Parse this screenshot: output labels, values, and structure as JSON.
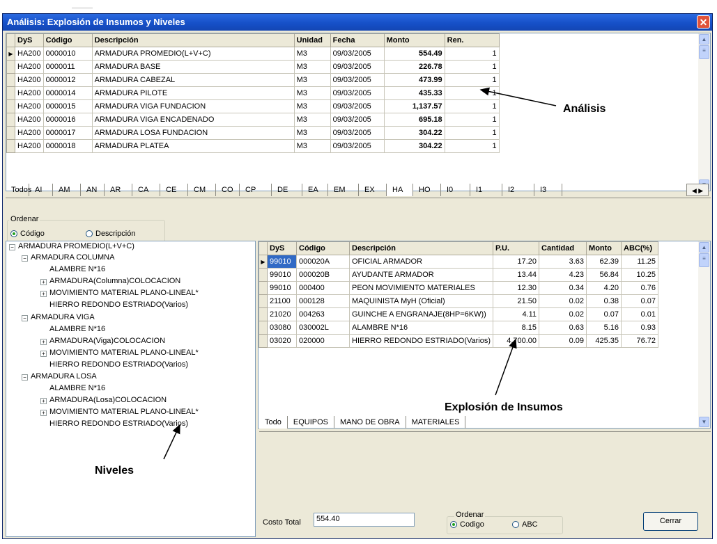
{
  "window": {
    "title": "Análisis: Explosión de Insumos y Niveles",
    "close": "✕"
  },
  "analisis": {
    "headers": [
      "DyS",
      "Código",
      "Descripción",
      "Unidad",
      "Fecha",
      "Monto",
      "Ren."
    ],
    "rows": [
      [
        "HA200",
        "0000010",
        "ARMADURA PROMEDIO(L+V+C)",
        "M3",
        "09/03/2005",
        "554.49",
        "1"
      ],
      [
        "HA200",
        "0000011",
        "ARMADURA BASE",
        "M3",
        "09/03/2005",
        "226.78",
        "1"
      ],
      [
        "HA200",
        "0000012",
        "ARMADURA CABEZAL",
        "M3",
        "09/03/2005",
        "473.99",
        "1"
      ],
      [
        "HA200",
        "0000014",
        "ARMADURA PILOTE",
        "M3",
        "09/03/2005",
        "435.33",
        "1"
      ],
      [
        "HA200",
        "0000015",
        "ARMADURA VIGA FUNDACION",
        "M3",
        "09/03/2005",
        "1,137.57",
        "1"
      ],
      [
        "HA200",
        "0000016",
        "ARMADURA VIGA ENCADENADO",
        "M3",
        "09/03/2005",
        "695.18",
        "1"
      ],
      [
        "HA200",
        "0000017",
        "ARMADURA LOSA FUNDACION",
        "M3",
        "09/03/2005",
        "304.22",
        "1"
      ],
      [
        "HA200",
        "0000018",
        "ARMADURA PLATEA",
        "M3",
        "09/03/2005",
        "304.22",
        "1"
      ]
    ]
  },
  "letter_tabs": [
    "Todos",
    "AI",
    "AM",
    "AN",
    "AR",
    "CA",
    "CE",
    "CM",
    "CO",
    "CP",
    "DE",
    "EA",
    "EM",
    "EX",
    "HA",
    "HO",
    "I0",
    "I1",
    "I2",
    "I3"
  ],
  "ordenar_top": {
    "label": "Ordenar",
    "opt1": "Código",
    "opt2": "Descripción"
  },
  "tree": {
    "root": "ARMADURA PROMEDIO(L+V+C)",
    "nodes": [
      "ARMADURA COLUMNA",
      "ALAMBRE N*16",
      "ARMADURA(Columna)COLOCACION",
      "MOVIMIENTO MATERIAL PLANO-LINEAL*",
      "HIERRO REDONDO ESTRIADO(Varios)",
      "ARMADURA VIGA",
      "ALAMBRE N*16",
      "ARMADURA(Viga)COLOCACION",
      "MOVIMIENTO MATERIAL PLANO-LINEAL*",
      "HIERRO REDONDO ESTRIADO(Varios)",
      "ARMADURA LOSA",
      "ALAMBRE N*16",
      "ARMADURA(Losa)COLOCACION",
      "MOVIMIENTO MATERIAL PLANO-LINEAL*",
      "HIERRO REDONDO ESTRIADO(Varios)"
    ]
  },
  "insumos": {
    "headers": [
      "DyS",
      "Código",
      "Descripción",
      "P.U.",
      "Cantidad",
      "Monto",
      "ABC(%)"
    ],
    "rows": [
      [
        "99010",
        "000020A",
        "OFICIAL ARMADOR",
        "17.20",
        "3.63",
        "62.39",
        "11.25"
      ],
      [
        "99010",
        "000020B",
        "AYUDANTE ARMADOR",
        "13.44",
        "4.23",
        "56.84",
        "10.25"
      ],
      [
        "99010",
        "000400",
        "PEON MOVIMIENTO MATERIALES",
        "12.30",
        "0.34",
        "4.20",
        "0.76"
      ],
      [
        "21100",
        "000128",
        "MAQUINISTA MyH (Oficial)",
        "21.50",
        "0.02",
        "0.38",
        "0.07"
      ],
      [
        "21020",
        "004263",
        "GUINCHE A ENGRANAJE(8HP=6KW))",
        "4.11",
        "0.02",
        "0.07",
        "0.01"
      ],
      [
        "03080",
        "030002L",
        "ALAMBRE N*16",
        "8.15",
        "0.63",
        "5.16",
        "0.93"
      ],
      [
        "03020",
        "020000",
        "HIERRO REDONDO ESTRIADO(Varios)",
        "4,700.00",
        "0.09",
        "425.35",
        "76.72"
      ]
    ]
  },
  "bottom_tabs": [
    "Todo",
    "EQUIPOS",
    "MANO DE OBRA",
    "MATERIALES"
  ],
  "costo_total": {
    "label": "Costo Total",
    "value": "554.40"
  },
  "ordenar_bottom": {
    "label": "Ordenar",
    "opt1": "Codigo",
    "opt2": "ABC"
  },
  "cerrar": "Cerrar",
  "annotations": {
    "analisis": "Análisis",
    "explosion": "Explosión de Insumos",
    "niveles": "Niveles"
  }
}
